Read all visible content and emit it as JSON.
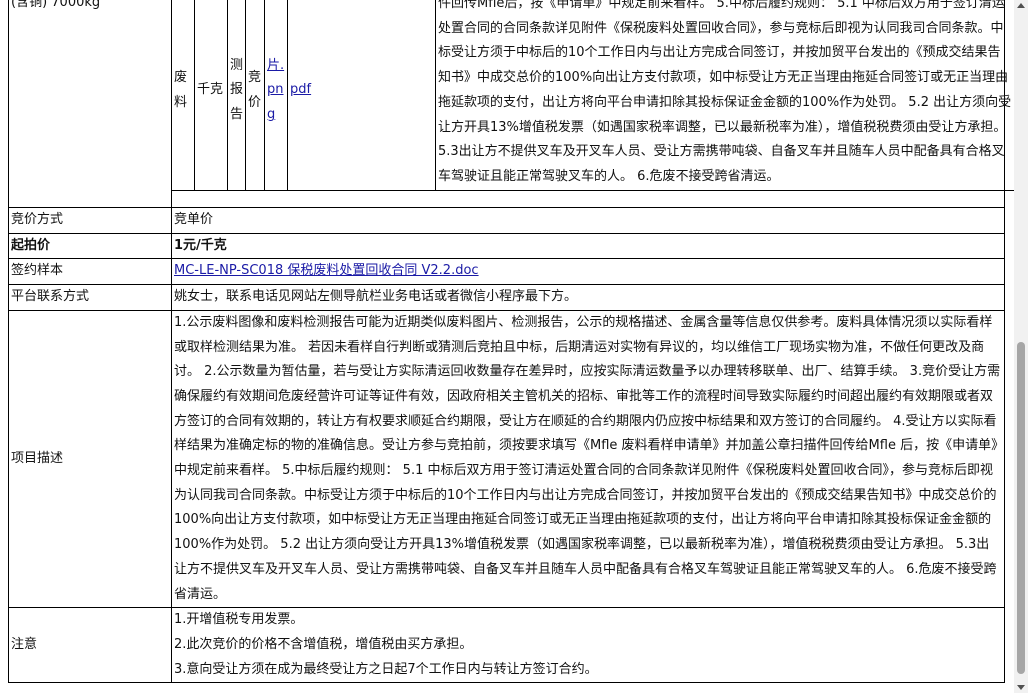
{
  "top_row": {
    "quantity": "(含铜) 7000kg",
    "cells": [
      "废料",
      "千克",
      "测报告",
      "竞价",
      "片.png",
      "pdf"
    ],
    "text": "件回传Mfle后，按《申请单》中规定前来看样。 5.中标后履约规则： 5.1 中标后双方用于签订清运处置合同的合同条款详见附件《保税废料处置回收合同》，参与竞标后即视为认同我司合同条款。中标受让方须于中标后的10个工作日内与出让方完成合同签订，并按加贸平台发出的《预成交结果告知书》中成交总价的100%向出让方支付款项，如中标受让方无正当理由拖延合同签订或无正当理由拖延款项的支付，出让方将向平台申请扣除其投标保证金金额的100%作为处罚。 5.2 出让方须向受让方开具13%增值税发票（如遇国家税率调整，已以最新税率为准），增值税税费须由受让方承担。 5.3出让方不提供叉车及开叉车人员、受让方需携带吨袋、自备叉车并且随车人员中配备具有合格叉车驾驶证且能正常驾驶叉车的人。 6.危废不接受跨省清运。"
  },
  "rows": [
    {
      "label": "竞价方式",
      "value": "竞单价"
    },
    {
      "label": "起拍价",
      "value": "1元/千克"
    },
    {
      "label": "签约样本",
      "value": "MC-LE-NP-SC018 保税废料处置回收合同 V2.2.doc"
    },
    {
      "label": "平台联系方式",
      "value": "姚女士，联系电话见网站左侧导航栏业务电话或者微信小程序最下方。"
    },
    {
      "label": "项目描述",
      "value": "1.公示废料图像和废料检测报告可能为近期类似废料图片、检测报告，公示的规格描述、金属含量等信息仅供参考。废料具体情况须以实际看样或取样检测结果为准。 若因未看样自行判断或猜测后竞拍且中标，后期清运对实物有异议的，均以维信工厂现场实物为准，不做任何更改及商讨。 2.公示数量为暂估量，若与受让方实际清运回收数量存在差异时，应按实际清运数量予以办理转移联单、出厂、结算手续。 3.竞价受让方需确保履约有效期间危废经营许可证等证件有效，因政府相关主管机关的招标、审批等工作的流程时间导致实际履约时间超出履约有效期限或者双方签订的合同有效期的，转让方有权要求顺延合约期限，受让方在顺延的合约期限内仍应按中标结果和双方签订的合同履约。 4.受让方以实际看样结果为准确定标的物的准确信息。受让方参与竞拍前，须按要求填写《Mfle 废料看样申请单》并加盖公章扫描件回传给Mfle 后，按《申请单》中规定前来看样。 5.中标后履约规则： 5.1 中标后双方用于签订清运处置合同的合同条款详见附件《保税废料处置回收合同》，参与竞标后即视为认同我司合同条款。中标受让方须于中标后的10个工作日内与出让方完成合同签订，并按加贸平台发出的《预成交结果告知书》中成交总价的100%向出让方支付款项，如中标受让方无正当理由拖延合同签订或无正当理由拖延款项的支付，出让方将向平台申请扣除其投标保证金金额的100%作为处罚。 5.2 出让方须向受让方开具13%增值税发票（如遇国家税率调整，已以最新税率为准），增值税税费须由受让方承担。 5.3出让方不提供叉车及开叉车人员、受让方需携带吨袋、自备叉车并且随车人员中配备具有合格叉车驾驶证且能正常驾驶叉车的人。 6.危废不接受跨省清运。"
    },
    {
      "label": "注意",
      "lines": [
        "1.开增值税专用发票。",
        "2.此次竞价的价格不含增值税，增值税由买方承担。",
        "3.意向受让方须在成为最终受让方之日起7个工作日内与转让方签订合约。"
      ]
    }
  ]
}
